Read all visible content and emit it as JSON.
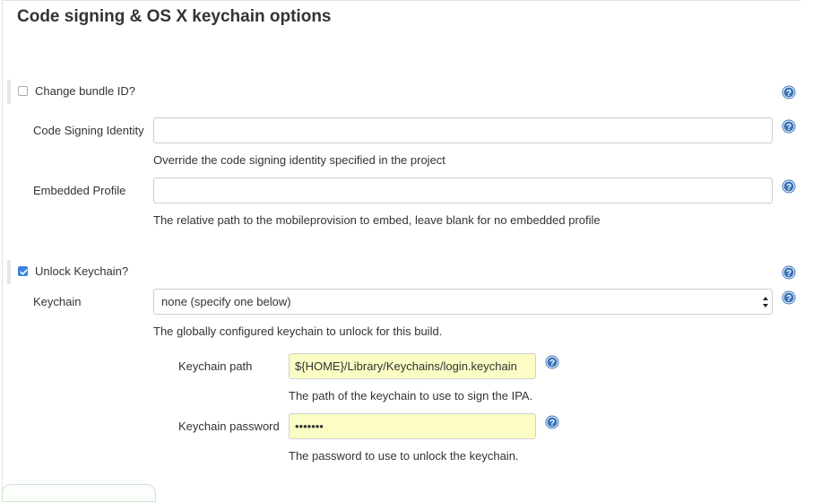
{
  "section": {
    "title": "Code signing & OS X keychain options"
  },
  "change_bundle_id": {
    "label": "Change bundle ID?",
    "checked": false
  },
  "code_signing_identity": {
    "label": "Code Signing Identity",
    "value": "",
    "description": "Override the code signing identity specified in the project"
  },
  "embedded_profile": {
    "label": "Embedded Profile",
    "value": "",
    "description": "The relative path to the mobileprovision to embed, leave blank for no embedded profile"
  },
  "unlock_keychain": {
    "label": "Unlock Keychain?",
    "checked": true
  },
  "keychain": {
    "label": "Keychain",
    "selected": "none (specify one below)",
    "description": "The globally configured keychain to unlock for this build."
  },
  "keychain_path": {
    "label": "Keychain path",
    "value": "${HOME}/Library/Keychains/login.keychain",
    "description": "The path of the keychain to use to sign the IPA."
  },
  "keychain_password": {
    "label": "Keychain password",
    "value": "•••••••",
    "description": "The password to use to unlock the keychain."
  },
  "icons": {
    "help": "help-icon",
    "checkmark": "checkmark-icon",
    "select_arrows": "select-arrows-icon"
  },
  "colors": {
    "help_icon": "#3b73b9",
    "checkbox_checked": "#3b83e0",
    "autofill_field": "#fbfdc4"
  }
}
